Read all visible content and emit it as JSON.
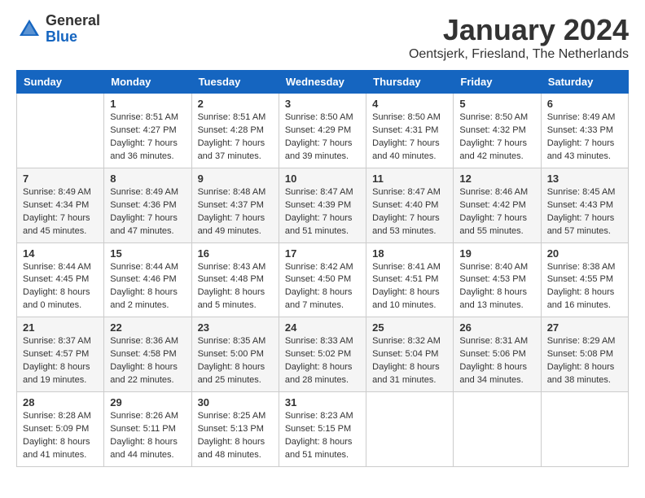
{
  "header": {
    "logo_general": "General",
    "logo_blue": "Blue",
    "title": "January 2024",
    "subtitle": "Oentsjerk, Friesland, The Netherlands"
  },
  "calendar": {
    "columns": [
      "Sunday",
      "Monday",
      "Tuesday",
      "Wednesday",
      "Thursday",
      "Friday",
      "Saturday"
    ],
    "rows": [
      [
        {
          "day": "",
          "info": ""
        },
        {
          "day": "1",
          "info": "Sunrise: 8:51 AM\nSunset: 4:27 PM\nDaylight: 7 hours\nand 36 minutes."
        },
        {
          "day": "2",
          "info": "Sunrise: 8:51 AM\nSunset: 4:28 PM\nDaylight: 7 hours\nand 37 minutes."
        },
        {
          "day": "3",
          "info": "Sunrise: 8:50 AM\nSunset: 4:29 PM\nDaylight: 7 hours\nand 39 minutes."
        },
        {
          "day": "4",
          "info": "Sunrise: 8:50 AM\nSunset: 4:31 PM\nDaylight: 7 hours\nand 40 minutes."
        },
        {
          "day": "5",
          "info": "Sunrise: 8:50 AM\nSunset: 4:32 PM\nDaylight: 7 hours\nand 42 minutes."
        },
        {
          "day": "6",
          "info": "Sunrise: 8:49 AM\nSunset: 4:33 PM\nDaylight: 7 hours\nand 43 minutes."
        }
      ],
      [
        {
          "day": "7",
          "info": "Sunrise: 8:49 AM\nSunset: 4:34 PM\nDaylight: 7 hours\nand 45 minutes."
        },
        {
          "day": "8",
          "info": "Sunrise: 8:49 AM\nSunset: 4:36 PM\nDaylight: 7 hours\nand 47 minutes."
        },
        {
          "day": "9",
          "info": "Sunrise: 8:48 AM\nSunset: 4:37 PM\nDaylight: 7 hours\nand 49 minutes."
        },
        {
          "day": "10",
          "info": "Sunrise: 8:47 AM\nSunset: 4:39 PM\nDaylight: 7 hours\nand 51 minutes."
        },
        {
          "day": "11",
          "info": "Sunrise: 8:47 AM\nSunset: 4:40 PM\nDaylight: 7 hours\nand 53 minutes."
        },
        {
          "day": "12",
          "info": "Sunrise: 8:46 AM\nSunset: 4:42 PM\nDaylight: 7 hours\nand 55 minutes."
        },
        {
          "day": "13",
          "info": "Sunrise: 8:45 AM\nSunset: 4:43 PM\nDaylight: 7 hours\nand 57 minutes."
        }
      ],
      [
        {
          "day": "14",
          "info": "Sunrise: 8:44 AM\nSunset: 4:45 PM\nDaylight: 8 hours\nand 0 minutes."
        },
        {
          "day": "15",
          "info": "Sunrise: 8:44 AM\nSunset: 4:46 PM\nDaylight: 8 hours\nand 2 minutes."
        },
        {
          "day": "16",
          "info": "Sunrise: 8:43 AM\nSunset: 4:48 PM\nDaylight: 8 hours\nand 5 minutes."
        },
        {
          "day": "17",
          "info": "Sunrise: 8:42 AM\nSunset: 4:50 PM\nDaylight: 8 hours\nand 7 minutes."
        },
        {
          "day": "18",
          "info": "Sunrise: 8:41 AM\nSunset: 4:51 PM\nDaylight: 8 hours\nand 10 minutes."
        },
        {
          "day": "19",
          "info": "Sunrise: 8:40 AM\nSunset: 4:53 PM\nDaylight: 8 hours\nand 13 minutes."
        },
        {
          "day": "20",
          "info": "Sunrise: 8:38 AM\nSunset: 4:55 PM\nDaylight: 8 hours\nand 16 minutes."
        }
      ],
      [
        {
          "day": "21",
          "info": "Sunrise: 8:37 AM\nSunset: 4:57 PM\nDaylight: 8 hours\nand 19 minutes."
        },
        {
          "day": "22",
          "info": "Sunrise: 8:36 AM\nSunset: 4:58 PM\nDaylight: 8 hours\nand 22 minutes."
        },
        {
          "day": "23",
          "info": "Sunrise: 8:35 AM\nSunset: 5:00 PM\nDaylight: 8 hours\nand 25 minutes."
        },
        {
          "day": "24",
          "info": "Sunrise: 8:33 AM\nSunset: 5:02 PM\nDaylight: 8 hours\nand 28 minutes."
        },
        {
          "day": "25",
          "info": "Sunrise: 8:32 AM\nSunset: 5:04 PM\nDaylight: 8 hours\nand 31 minutes."
        },
        {
          "day": "26",
          "info": "Sunrise: 8:31 AM\nSunset: 5:06 PM\nDaylight: 8 hours\nand 34 minutes."
        },
        {
          "day": "27",
          "info": "Sunrise: 8:29 AM\nSunset: 5:08 PM\nDaylight: 8 hours\nand 38 minutes."
        }
      ],
      [
        {
          "day": "28",
          "info": "Sunrise: 8:28 AM\nSunset: 5:09 PM\nDaylight: 8 hours\nand 41 minutes."
        },
        {
          "day": "29",
          "info": "Sunrise: 8:26 AM\nSunset: 5:11 PM\nDaylight: 8 hours\nand 44 minutes."
        },
        {
          "day": "30",
          "info": "Sunrise: 8:25 AM\nSunset: 5:13 PM\nDaylight: 8 hours\nand 48 minutes."
        },
        {
          "day": "31",
          "info": "Sunrise: 8:23 AM\nSunset: 5:15 PM\nDaylight: 8 hours\nand 51 minutes."
        },
        {
          "day": "",
          "info": ""
        },
        {
          "day": "",
          "info": ""
        },
        {
          "day": "",
          "info": ""
        }
      ]
    ]
  }
}
